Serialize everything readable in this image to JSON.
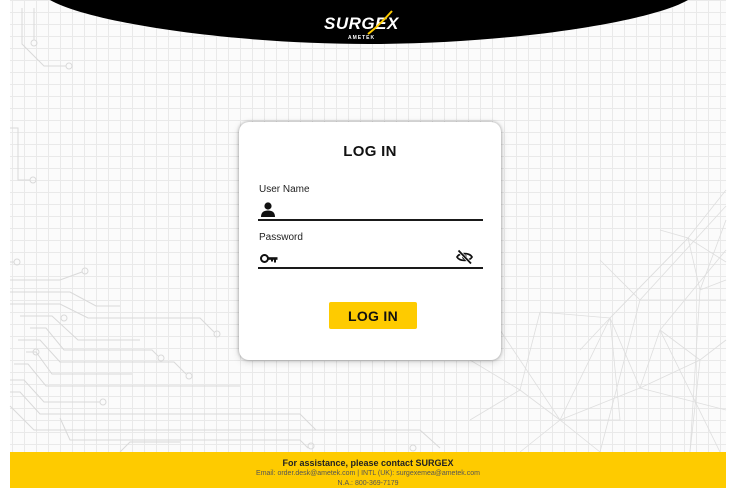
{
  "brand": {
    "logo_word": "SURGEX",
    "logo_sub": "AMETEK"
  },
  "login": {
    "title": "LOG IN",
    "username_label": "User Name",
    "username_value": "",
    "password_label": "Password",
    "password_value": "",
    "submit_label": "LOG IN"
  },
  "icons": {
    "username": "person-icon",
    "password": "key-icon",
    "toggle_visibility": "eye-slash-icon"
  },
  "footer": {
    "heading": "For assistance, please contact SURGEX",
    "email_prefix": "Email: ",
    "email_na": "order.desk@ametek.com",
    "separator": " | INTL (UK): ",
    "email_intl": "surgexemea@ametek.com",
    "phone": "N.A.: 800-369-7179"
  },
  "colors": {
    "accent": "#fecb00",
    "banner": "#000000",
    "text": "#111111",
    "page_bg": "#fbfbfb"
  }
}
